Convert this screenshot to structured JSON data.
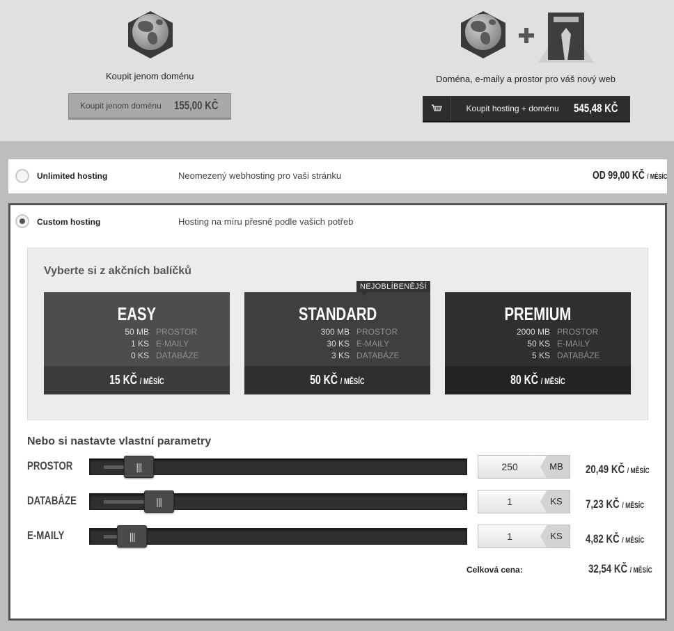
{
  "domain_offer": {
    "only_label": "Koupit jenom doménu",
    "only_button_label": "Koupit jenom doménu",
    "only_button_price": "155,00 KČ",
    "combo_label": "Doména, e-maily a prostor pro váš nový web",
    "combo_button_label": "Koupit hosting + doménu",
    "combo_button_price": "545,48 KČ",
    "icons": [
      "globe-icon",
      "plus-icon",
      "server-icon",
      "cart-icon"
    ]
  },
  "options": [
    {
      "title": "Unlimited hosting",
      "description": "Neomezený webhosting pro vaši stránku",
      "price": "OD 99,00 KČ",
      "price_unit": "/ MĚSÍC",
      "selected": false
    },
    {
      "title": "Custom hosting",
      "description": "Hosting na míru přesně podle vašich potřeb",
      "selected": true
    }
  ],
  "packages": {
    "title": "Vyberte si z akčních balíčků",
    "badge": "NEJOBLÍBENĚJŠÍ",
    "items": [
      {
        "name": "EASY",
        "specs": [
          {
            "value": "50 MB",
            "label": "PROSTOR"
          },
          {
            "value": "1 KS",
            "label": "E-MAILY"
          },
          {
            "value": "0 KS",
            "label": "DATABÁZE"
          }
        ],
        "price": "15 KČ",
        "unit": "/ MĚSÍC"
      },
      {
        "name": "STANDARD",
        "specs": [
          {
            "value": "300 MB",
            "label": "PROSTOR"
          },
          {
            "value": "30 KS",
            "label": "E-MAILY"
          },
          {
            "value": "3 KS",
            "label": "DATABÁZE"
          }
        ],
        "price": "50 KČ",
        "unit": "/ MĚSÍC"
      },
      {
        "name": "PREMIUM",
        "specs": [
          {
            "value": "2000 MB",
            "label": "PROSTOR"
          },
          {
            "value": "50 KS",
            "label": "E-MAILY"
          },
          {
            "value": "5 KS",
            "label": "DATABÁZE"
          }
        ],
        "price": "80 KČ",
        "unit": "/ MĚSÍC"
      }
    ]
  },
  "custom": {
    "title": "Nebo si nastavte vlastní parametry",
    "rows": [
      {
        "label": "PROSTOR",
        "value": "250",
        "unit": "MB",
        "price": "20,49 KČ",
        "price_unit": "/ MĚSÍC",
        "slider_fraction": 0.06
      },
      {
        "label": "DATABÁZE",
        "value": "1",
        "unit": "KS",
        "price": "7,23 KČ",
        "price_unit": "/ MĚSÍC",
        "slider_fraction": 0.12
      },
      {
        "label": "E-MAILY",
        "value": "1",
        "unit": "KS",
        "price": "4,82 KČ",
        "price_unit": "/ MĚSÍC",
        "slider_fraction": 0.04
      }
    ],
    "total_label": "Celková cena:",
    "total_price": "32,54 KČ",
    "total_unit": "/ MĚSÍC"
  }
}
